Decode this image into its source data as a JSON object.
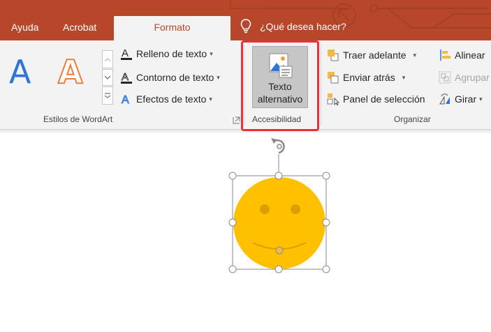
{
  "tabs": {
    "ayuda": "Ayuda",
    "acrobat": "Acrobat",
    "formato": "Formato"
  },
  "tell_me": {
    "text": "¿Qué desea hacer?",
    "icon": "lightbulb-icon"
  },
  "wordart_styles": {
    "sample_letter": "A",
    "group_label": "Estilos de WordArt",
    "text_fill": "Relleno de texto",
    "text_outline": "Contorno de texto",
    "text_effects": "Efectos de texto",
    "colors": {
      "blue": "#2e75d6",
      "orange": "#ee7d3b"
    }
  },
  "accessibility": {
    "alt_text_line1": "Texto",
    "alt_text_line2": "alternativo",
    "group_label": "Accesibilidad",
    "highlight_color": "#e8313a"
  },
  "arrange": {
    "bring_forward": "Traer adelante",
    "send_backward": "Enviar atrás",
    "selection_pane": "Panel de selección",
    "align": "Alinear",
    "group": "Agrupar",
    "rotate": "Girar",
    "group_label": "Organizar"
  },
  "shape": {
    "type": "smiley-face",
    "fill_color": "#ffc000",
    "feature_color": "#d9a000"
  },
  "theme": {
    "tab_bar": "#b7472a",
    "ribbon_bg": "#f3f3f3"
  }
}
